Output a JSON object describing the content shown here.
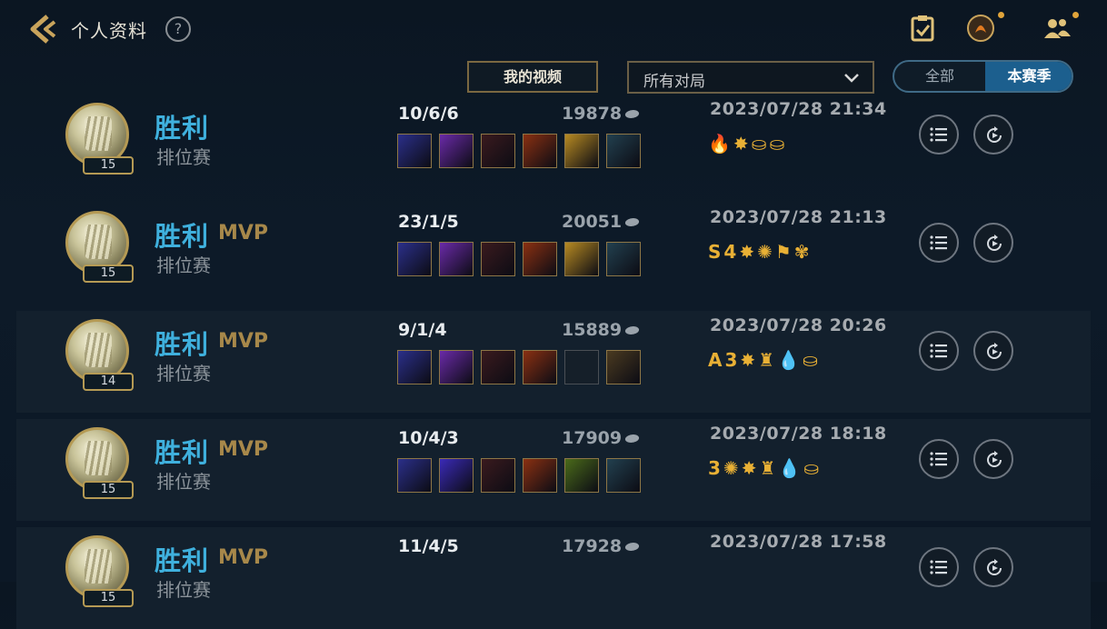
{
  "header": {
    "title": "个人资料",
    "help_label": "?",
    "icons": [
      "back-chevron-icon",
      "task-clipboard-icon",
      "profile-avatar-icon",
      "friends-icon"
    ]
  },
  "controls": {
    "video_button": "我的视频",
    "filter_value": "所有对局",
    "toggle": [
      "全部",
      "本赛季"
    ],
    "toggle_selected": "本赛季"
  },
  "colors": {
    "win": "#3fb0dd",
    "mvp": "#a7884a",
    "badge": "#e8b035",
    "accent": "#1c5f8e"
  },
  "matches": [
    {
      "result": "胜利",
      "mvp": "",
      "mode": "排位赛",
      "level": "15",
      "kda": "10/6/6",
      "gold": "19878",
      "date": "2023/07/28 21:34",
      "badges": [
        "🔥",
        "✸",
        "⛀",
        "⛀"
      ],
      "items": [
        "#2b2f8a",
        "#6a2aa8",
        "#3a1a1e",
        "#8a3012",
        "#b78a22",
        "#22404f"
      ]
    },
    {
      "result": "胜利",
      "mvp": "MVP",
      "mode": "排位赛",
      "level": "15",
      "kda": "23/1/5",
      "gold": "20051",
      "date": "2023/07/28 21:13",
      "badges": [
        "S",
        "4",
        "✸",
        "✺",
        "⚑",
        "✾"
      ],
      "items": [
        "#2b2f8a",
        "#6a2aa8",
        "#3a1a1e",
        "#8a3012",
        "#b78a22",
        "#22404f"
      ]
    },
    {
      "result": "胜利",
      "mvp": "MVP",
      "mode": "排位赛",
      "level": "14",
      "kda": "9/1/4",
      "gold": "15889",
      "date": "2023/07/28 20:26",
      "badges": [
        "A",
        "3",
        "✸",
        "♜",
        "💧",
        "⛀"
      ],
      "items": [
        "#2b2f8a",
        "#6a2aa8",
        "#3a1a1e",
        "#8a3012",
        "",
        "#4a3a20"
      ]
    },
    {
      "result": "胜利",
      "mvp": "MVP",
      "mode": "排位赛",
      "level": "15",
      "kda": "10/4/3",
      "gold": "17909",
      "date": "2023/07/28 18:18",
      "badges": [
        "3",
        "✺",
        "✸",
        "♜",
        "💧",
        "⛀"
      ],
      "items": [
        "#2b2f8a",
        "#3a2ab8",
        "#3a1a1e",
        "#8a3012",
        "#4a6a1a",
        "#22404f"
      ]
    },
    {
      "result": "胜利",
      "mvp": "MVP",
      "mode": "排位赛",
      "level": "15",
      "kda": "11/4/5",
      "gold": "17928",
      "date": "2023/07/28 17:58",
      "badges": [],
      "items": []
    }
  ]
}
